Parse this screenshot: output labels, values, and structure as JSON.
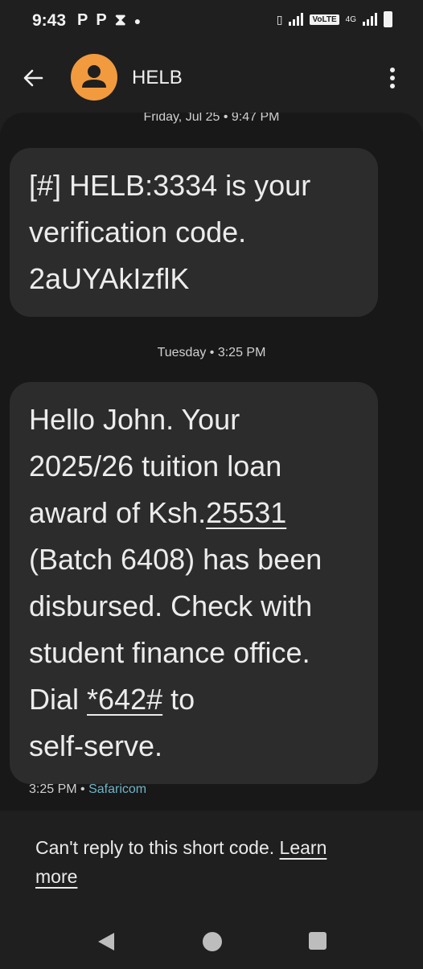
{
  "status_bar": {
    "time": "9:43",
    "left_icons": [
      "p-app-icon",
      "p-app-icon",
      "hourglass-icon",
      "dot-icon"
    ],
    "right_icons": [
      "vibrate-icon",
      "signal-icon",
      "volte-icon",
      "4g-signal-icon",
      "battery-icon"
    ],
    "volte_label": "VoLTE",
    "network_label": "4G"
  },
  "header": {
    "contact_name": "HELB",
    "avatar_color": "#f29a3e"
  },
  "conversation": {
    "messages": [
      {
        "timestamp": "Friday, Jul 25 • 9:47 PM",
        "lines": [
          "[#] HELB:3334 is your",
          "verification code.",
          "2aUYAkIzflK"
        ]
      },
      {
        "timestamp": "Tuesday • 3:25 PM",
        "line1": "Hello John. Your",
        "line2": "2025/26 tuition loan",
        "line3_pre": "award of Ksh.",
        "line3_link": "25531",
        "line4": "(Batch 6408) has been",
        "line5": "disbursed. Check with",
        "line6": "student finance office.",
        "line7_pre": "Dial ",
        "line7_link": "*642#",
        "line7_post": " to",
        "line8": "self-serve.",
        "meta_time": "3:25 PM",
        "meta_sep": " • ",
        "carrier": "Safaricom"
      }
    ]
  },
  "footer": {
    "text": "Can't reply to this short code. ",
    "learn_more": "Learn more"
  },
  "colors": {
    "background": "#181818",
    "bubble": "#2c2c2c",
    "carrier_link": "#6fb5c8",
    "avatar": "#f29a3e"
  }
}
